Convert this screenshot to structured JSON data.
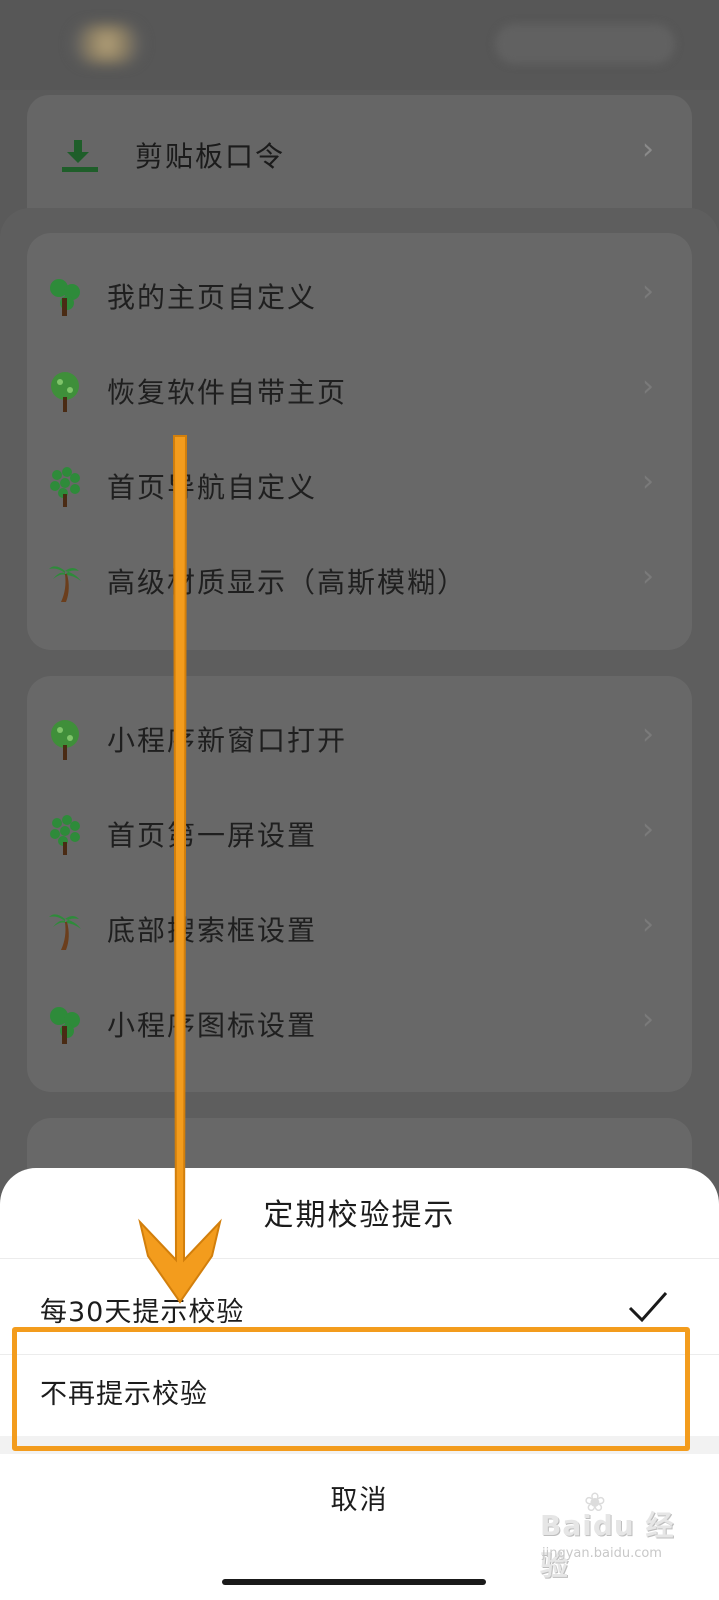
{
  "clipboard": {
    "label": "剪贴板口令",
    "icon": "download-icon"
  },
  "group1": [
    {
      "label": "我的主页自定义",
      "icon": "tree-round-icon"
    },
    {
      "label": "恢复软件自带主页",
      "icon": "tree-spotted-icon"
    },
    {
      "label": "首页导航自定义",
      "icon": "tree-dotted-icon"
    },
    {
      "label": "高级材质显示（高斯模糊）",
      "icon": "palm-tree-icon"
    }
  ],
  "group2": [
    {
      "label": "小程序新窗口打开",
      "icon": "tree-spotted-icon"
    },
    {
      "label": "首页第一屏设置",
      "icon": "tree-dotted-icon"
    },
    {
      "label": "底部搜索框设置",
      "icon": "palm-tree-icon"
    },
    {
      "label": "小程序图标设置",
      "icon": "tree-round-icon"
    }
  ],
  "action_sheet": {
    "title": "定期校验提示",
    "options": [
      {
        "label": "每30天提示校验",
        "selected": true
      },
      {
        "label": "不再提示校验",
        "selected": false
      }
    ],
    "cancel": "取消"
  },
  "colors": {
    "highlight": "#f39c1d",
    "tree_green": "#2e8b3a"
  },
  "watermark": {
    "logo": "Baidu 经验",
    "url": "jingyan.baidu.com"
  }
}
